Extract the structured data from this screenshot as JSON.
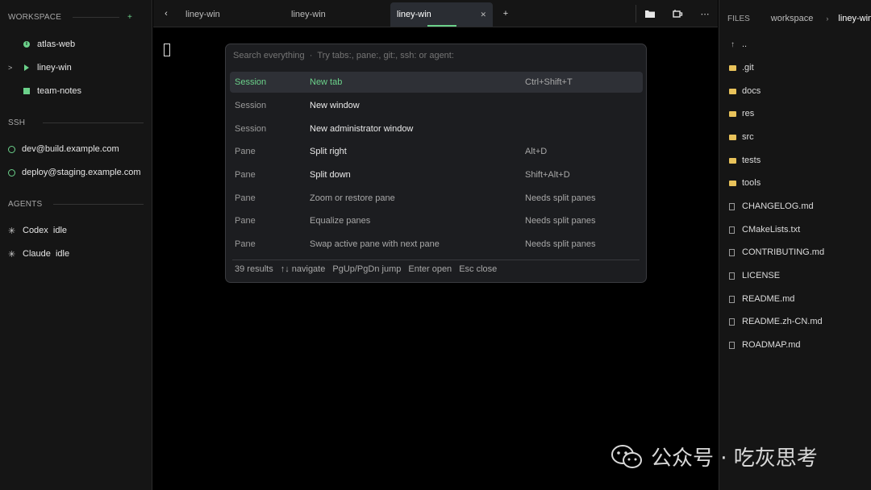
{
  "sidebar": {
    "workspace_label": "WORKSPACE",
    "add_label": "+",
    "workspaces": [
      {
        "label": "atlas-web",
        "icon": "info-dot-icon",
        "active": false
      },
      {
        "label": "liney-win",
        "icon": "play-icon",
        "active": true
      },
      {
        "label": "team-notes",
        "icon": "square-icon",
        "active": false
      }
    ],
    "active_marker": ">",
    "ssh_label": "SSH",
    "ssh_hosts": [
      {
        "label": "dev@build.example.com",
        "icon": "globe-icon"
      },
      {
        "label": "deploy@staging.example.com",
        "icon": "globe-icon"
      }
    ],
    "agents_label": "AGENTS",
    "agents": [
      {
        "label": "Codex  idle",
        "icon": "asterisk-icon"
      },
      {
        "label": "Claude  idle",
        "icon": "asterisk-icon"
      }
    ]
  },
  "tabbar": {
    "back_label": "‹",
    "tabs": [
      {
        "label": "liney-win",
        "active": false
      },
      {
        "label": "liney-win",
        "active": false
      },
      {
        "label": "liney-win",
        "active": true
      }
    ],
    "close_label": "✕",
    "new_tab_label": "+",
    "more_label": "⋯"
  },
  "palette": {
    "placeholder": "Search everything  ·  Try tabs:, pane:, git:, ssh: or agent:",
    "rows": [
      {
        "category": "Session",
        "name": "New tab",
        "shortcut": "Ctrl+Shift+T"
      },
      {
        "category": "Session",
        "name": "New window",
        "shortcut": ""
      },
      {
        "category": "Session",
        "name": "New administrator window",
        "shortcut": ""
      },
      {
        "category": "Pane",
        "name": "Split right",
        "shortcut": "Alt+D"
      },
      {
        "category": "Pane",
        "name": "Split down",
        "shortcut": "Shift+Alt+D"
      },
      {
        "category": "Pane",
        "name": "Zoom or restore pane",
        "shortcut": "Needs split panes"
      },
      {
        "category": "Pane",
        "name": "Equalize panes",
        "shortcut": "Needs split panes"
      },
      {
        "category": "Pane",
        "name": "Swap active pane with next pane",
        "shortcut": "Needs split panes"
      }
    ],
    "footer": {
      "results": "39 results",
      "navigate": "↑↓ navigate",
      "jump": "PgUp/PgDn jump",
      "open": "Enter open",
      "close": "Esc close"
    }
  },
  "files": {
    "header": "FILES",
    "breadcrumb_root": "workspace",
    "breadcrumb_sep": "›",
    "breadcrumb_current": "liney-win",
    "up_label": "..",
    "entries": [
      {
        "name": ".git",
        "type": "folder"
      },
      {
        "name": "docs",
        "type": "folder"
      },
      {
        "name": "res",
        "type": "folder"
      },
      {
        "name": "src",
        "type": "folder"
      },
      {
        "name": "tests",
        "type": "folder"
      },
      {
        "name": "tools",
        "type": "folder"
      },
      {
        "name": "CHANGELOG.md",
        "type": "file"
      },
      {
        "name": "CMakeLists.txt",
        "type": "file"
      },
      {
        "name": "CONTRIBUTING.md",
        "type": "file"
      },
      {
        "name": "LICENSE",
        "type": "file"
      },
      {
        "name": "README.md",
        "type": "file"
      },
      {
        "name": "README.zh-CN.md",
        "type": "file"
      },
      {
        "name": "ROADMAP.md",
        "type": "file"
      }
    ]
  },
  "watermark": {
    "text": "公众号 · 吃灰思考",
    "icon": "wechat-logo-icon"
  },
  "colors": {
    "accent": "#6bd18a",
    "folder": "#e8c25a",
    "background": "#000000",
    "panel": "#151515"
  }
}
